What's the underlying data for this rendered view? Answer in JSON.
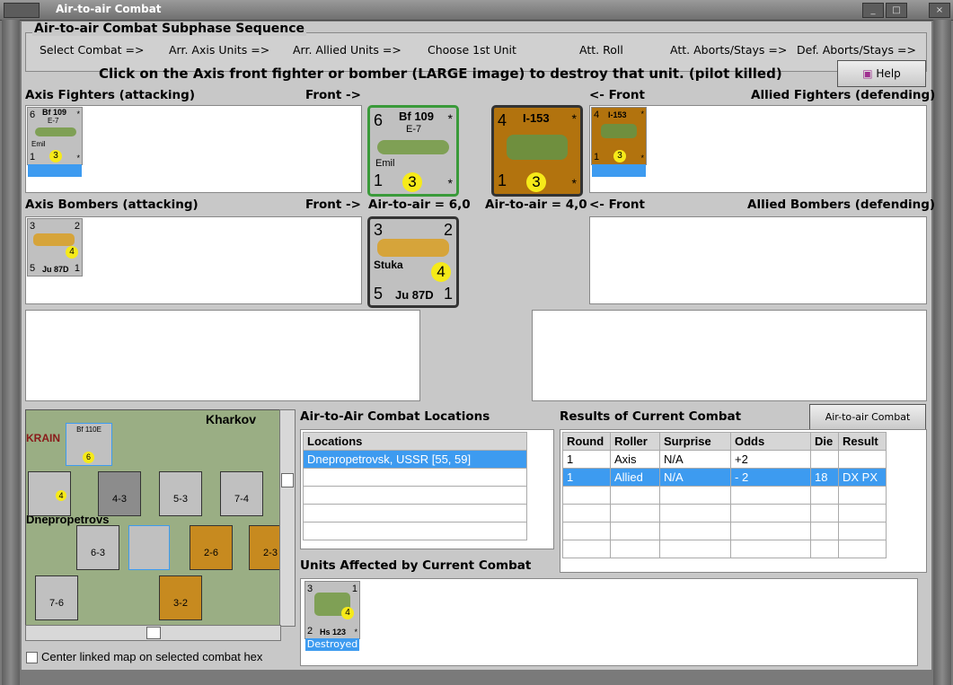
{
  "window": {
    "title": "Air-to-air Combat"
  },
  "sequence": {
    "title": "Air-to-air Combat Subphase Sequence",
    "steps": [
      "Select Combat =>",
      "Arr. Axis Units =>",
      "Arr. Allied Units =>",
      "Choose 1st Unit",
      "Att. Roll",
      "Att. Aborts/Stays =>",
      "Def. Aborts/Stays =>"
    ]
  },
  "instruction": "Click on the Axis front fighter or bomber (LARGE image) to destroy that unit. (pilot killed)",
  "help_label": "Help",
  "labels": {
    "axis_fighters": "Axis Fighters (attacking)",
    "front_right": "Front ->",
    "front_left": "<- Front",
    "allied_fighters": "Allied Fighters (defending)",
    "axis_bombers": "Axis Bombers (attacking)",
    "axis_air_to_air": "Air-to-air = 6,0",
    "allied_air_to_air": "Air-to-air = 4,0",
    "allied_bombers": "Allied Bombers (defending)",
    "locations_title": "Air-to-Air Combat Locations",
    "results_title": "Results of Current Combat",
    "units_affected": "Units Affected by Current Combat",
    "center_map": "Center linked map on selected combat hex",
    "chart_button": "Air-to-air Combat Chart"
  },
  "units": {
    "axis_fighter": {
      "name": "Bf 109",
      "variant": "E-7",
      "nick": "Emil",
      "tl": "6",
      "bl": "1",
      "tr": "*",
      "br": "*",
      "circle": "3"
    },
    "allied_fighter": {
      "name": "I-153",
      "tl": "4",
      "bl": "1",
      "tr": "*",
      "br": "*",
      "circle": "3"
    },
    "axis_bomber": {
      "name": "Stuka",
      "type": "Ju 87D",
      "tl": "3",
      "tr": "2",
      "bl": "5",
      "br": "1",
      "circle": "4"
    },
    "affected": {
      "name": "Hs 123",
      "tl": "3",
      "tr": "1",
      "bl": "2",
      "br": "*",
      "circle": "4",
      "status": "Destroyed"
    }
  },
  "locations": {
    "header": "Locations",
    "rows": [
      "Dnepropetrovsk, USSR [55, 59]"
    ]
  },
  "results": {
    "headers": [
      "Round",
      "Roller",
      "Surprise",
      "Odds",
      "Die",
      "Result"
    ],
    "rows": [
      [
        "1",
        "Axis",
        "N/A",
        "+2",
        "",
        ""
      ],
      [
        "1",
        "Allied",
        "N/A",
        "- 2",
        "18",
        "DX PX"
      ]
    ]
  },
  "map": {
    "labels": [
      "Kharkov",
      "KRAIN",
      "Dnepropetrovs"
    ],
    "counters": [
      {
        "v": "4-3"
      },
      {
        "v": "5-3"
      },
      {
        "v": "7-4"
      },
      {
        "v": "6-3"
      },
      {
        "v": "2-6"
      },
      {
        "v": "2-3"
      },
      {
        "v": "7-6"
      },
      {
        "v": "3-2"
      },
      {
        "v": "6-3"
      }
    ],
    "mini_plane": "Bf 110E",
    "mini_circle": "6",
    "stuka_circle": "4"
  },
  "colors": {
    "selection": "#3d9bf0",
    "allied": "#b2730e",
    "axis": "#c0c0c0",
    "circle": "#f6ea19"
  }
}
